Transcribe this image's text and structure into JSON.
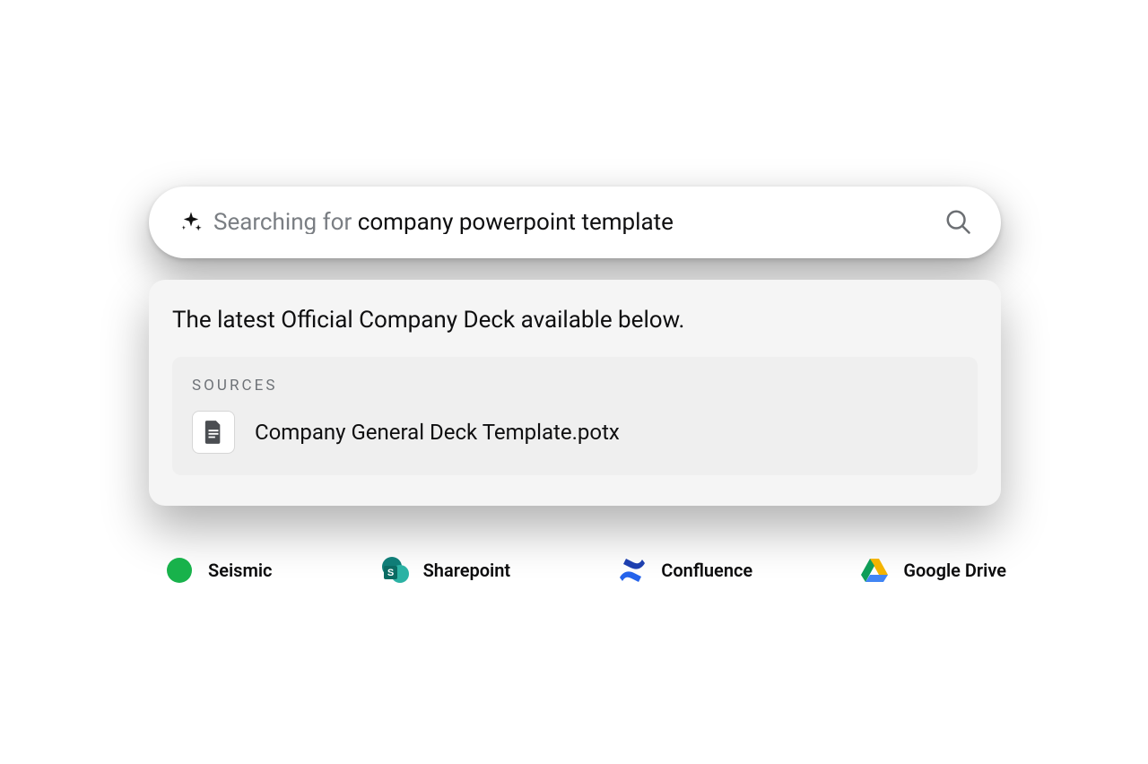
{
  "search": {
    "prefix": "Searching for ",
    "query": "company powerpoint template"
  },
  "result": {
    "answer": "The latest Official Company Deck available below.",
    "sources_label": "SOURCES",
    "sources": [
      {
        "filename": "Company General Deck Template.potx"
      }
    ]
  },
  "integrations": [
    {
      "id": "seismic",
      "label": "Seismic"
    },
    {
      "id": "sharepoint",
      "label": "Sharepoint"
    },
    {
      "id": "confluence",
      "label": "Confluence"
    },
    {
      "id": "gdrive",
      "label": "Google Drive"
    }
  ]
}
